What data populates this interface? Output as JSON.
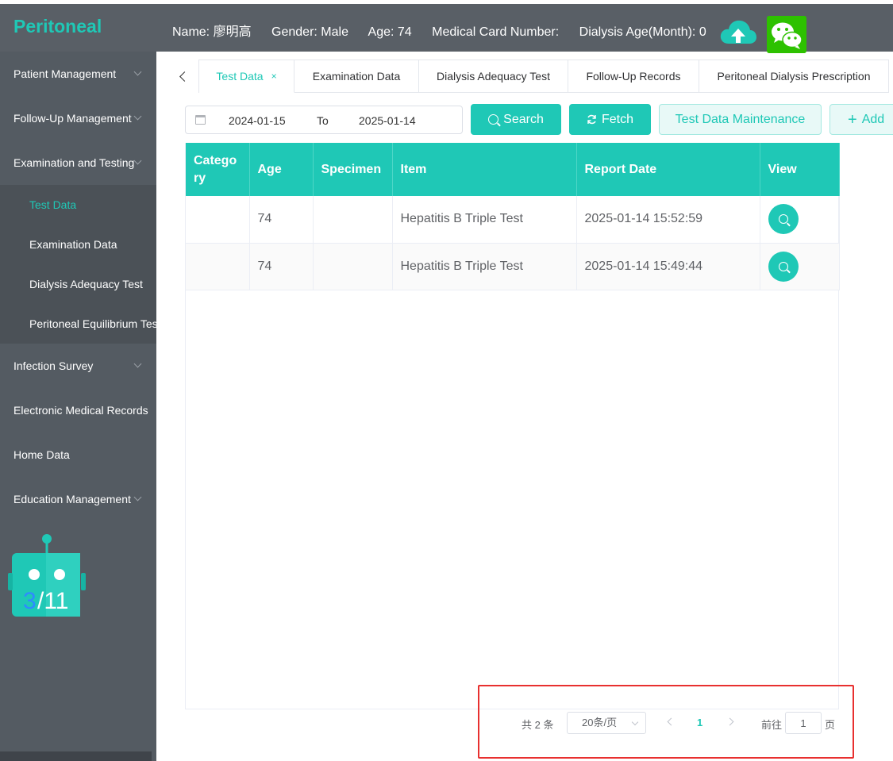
{
  "app": {
    "title": "Peritoneal"
  },
  "patient": {
    "name": "Name: 廖明高",
    "gender": "Gender: Male",
    "age": "Age: 74",
    "card": "Medical Card Number:",
    "dialysis_age": "Dialysis Age(Month): 0"
  },
  "header_icons": [
    "cloud-upload-icon",
    "wechat-icon"
  ],
  "sidebar": {
    "items": [
      {
        "label": "Patient Management"
      },
      {
        "label": "Follow-Up Management"
      },
      {
        "label": "Examination and Testing"
      },
      {
        "label": "Infection Survey"
      },
      {
        "label": "Electronic Medical Records"
      },
      {
        "label": "Home Data"
      },
      {
        "label": "Education Management"
      }
    ],
    "subitems": [
      {
        "label": "Test Data"
      },
      {
        "label": "Examination Data"
      },
      {
        "label": "Dialysis Adequacy Test"
      },
      {
        "label": "Peritoneal Equilibrium Test"
      }
    ],
    "robot": {
      "current": "3",
      "total": "/11"
    }
  },
  "tabs": [
    {
      "label": "Test Data",
      "close": "×"
    },
    {
      "label": "Examination Data"
    },
    {
      "label": "Dialysis Adequacy Test"
    },
    {
      "label": "Follow-Up Records"
    },
    {
      "label": "Peritoneal Dialysis Prescription"
    }
  ],
  "filters": {
    "start_date": "2024-01-15",
    "separator": "To",
    "end_date": "2025-01-14"
  },
  "buttons": {
    "search": "Search",
    "fetch": "Fetch",
    "maintenance": "Test Data Maintenance",
    "add": "Add"
  },
  "table": {
    "headers": [
      "Catego ry",
      "Age",
      "Specimen",
      "Item",
      "Report Date",
      "View"
    ],
    "rows": [
      {
        "category": "",
        "age": "74",
        "specimen": "",
        "item": "Hepatitis B Triple Test",
        "report_date": "2025-01-14 15:52:59"
      },
      {
        "category": "",
        "age": "74",
        "specimen": "",
        "item": "Hepatitis B Triple Test",
        "report_date": "2025-01-14 15:49:44"
      }
    ]
  },
  "pagination": {
    "total": "共 2 条",
    "page_size": "20条/页",
    "current_page": "1",
    "goto_label": "前往",
    "goto_value": "1",
    "page_suffix": "页"
  },
  "colors": {
    "accent": "#1fc8b6",
    "sidebar": "#545b62",
    "header": "#595f66",
    "highlight_box": "#e8302f"
  }
}
